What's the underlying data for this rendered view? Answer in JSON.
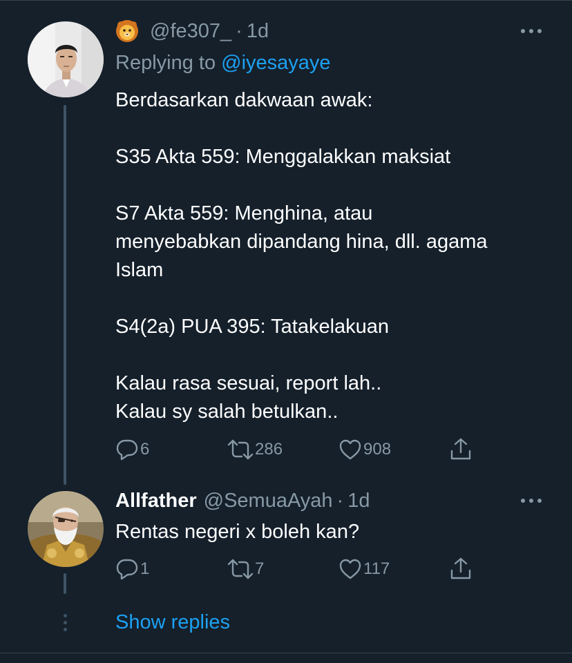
{
  "tweet1": {
    "emoji_icon": "lion-face-icon",
    "handle": "@fe307_",
    "separator": "·",
    "time": "1d",
    "replying_prefix": "Replying to",
    "replying_mention": "@iyesayaye",
    "text": "Berdasarkan dakwaan awak:\n\nS35 Akta 559: Menggalakkan maksiat\n\nS7 Akta 559: Menghina, atau\nmenyebabkan dipandang hina, dll. agama\nIslam\n\nS4(2a) PUA 395: Tatakelakuan\n\nKalau rasa sesuai, report lah..\nKalau sy salah betulkan..",
    "replies": "6",
    "retweets": "286",
    "likes": "908"
  },
  "tweet2": {
    "display_name": "Allfather",
    "handle": "@SemuaAyah",
    "separator": "·",
    "time": "1d",
    "text": "Rentas negeri x boleh kan?",
    "replies": "1",
    "retweets": "7",
    "likes": "117"
  },
  "show_replies": "Show replies",
  "colors": {
    "background": "#15202b",
    "secondary_text": "#8899a6",
    "accent": "#1da1f2",
    "thread_line": "#3d5466"
  }
}
